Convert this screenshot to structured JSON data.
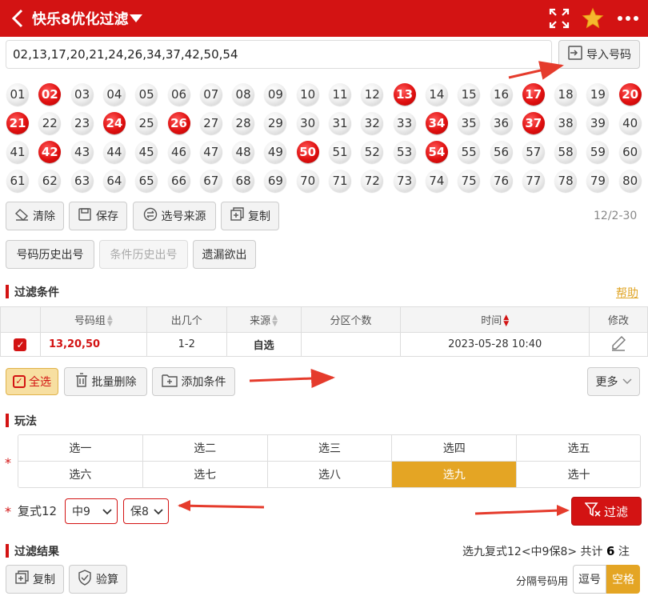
{
  "header": {
    "title": "快乐8优化过滤",
    "icons": [
      "back-arrow-icon",
      "dropdown-caret-icon",
      "fullscreen-icon",
      "star-icon",
      "more-icon"
    ]
  },
  "input": {
    "value": "02,13,17,20,21,24,26,34,37,42,50,54",
    "import_label": "导入号码"
  },
  "balls": [
    "01",
    "02",
    "03",
    "04",
    "05",
    "06",
    "07",
    "08",
    "09",
    "10",
    "11",
    "12",
    "13",
    "14",
    "15",
    "16",
    "17",
    "18",
    "19",
    "20",
    "21",
    "22",
    "23",
    "24",
    "25",
    "26",
    "27",
    "28",
    "29",
    "30",
    "31",
    "32",
    "33",
    "34",
    "35",
    "36",
    "37",
    "38",
    "39",
    "40",
    "41",
    "42",
    "43",
    "44",
    "45",
    "46",
    "47",
    "48",
    "49",
    "50",
    "51",
    "52",
    "53",
    "54",
    "55",
    "56",
    "57",
    "58",
    "59",
    "60",
    "61",
    "62",
    "63",
    "64",
    "65",
    "66",
    "67",
    "68",
    "69",
    "70",
    "71",
    "72",
    "73",
    "74",
    "75",
    "76",
    "77",
    "78",
    "79",
    "80"
  ],
  "selected_balls": [
    "02",
    "13",
    "17",
    "20",
    "21",
    "24",
    "26",
    "34",
    "37",
    "42",
    "50",
    "54"
  ],
  "toolbar": {
    "clear_label": "清除",
    "save_label": "保存",
    "source_label": "选号来源",
    "copy_label": "复制",
    "range": "12/2-30"
  },
  "history": {
    "number_history_label": "号码历史出号",
    "condition_history_label": "条件历史出号",
    "missing_label": "遗漏欲出"
  },
  "conditions": {
    "section_title": "过滤条件",
    "help_label": "帮助",
    "columns": [
      "号码组",
      "出几个",
      "来源",
      "分区个数",
      "时间",
      "修改"
    ],
    "rows": [
      {
        "group": "13,20,50",
        "count": "1-2",
        "source": "自选",
        "zones": "",
        "time": "2023-05-28 10:40"
      }
    ],
    "select_all_label": "全选",
    "batch_delete_label": "批量删除",
    "add_condition_label": "添加条件",
    "more_label": "更多"
  },
  "play": {
    "section_title": "玩法",
    "options": [
      "选一",
      "选二",
      "选三",
      "选四",
      "选五",
      "选六",
      "选七",
      "选八",
      "选九",
      "选十"
    ],
    "active": "选九",
    "compound_label": "复式12",
    "hit_select": "中9",
    "guarantee_select": "保8",
    "filter_label": "过滤"
  },
  "results": {
    "section_title": "过滤结果",
    "summary_prefix": "选九复式12<中9保8>  共计",
    "summary_count": "6",
    "summary_unit": "注",
    "copy_label": "复制",
    "verify_label": "验算",
    "separator_label": "分隔号码用",
    "comma_label": "逗号",
    "space_label": "空格"
  },
  "colors": {
    "brand_red": "#d31313",
    "gold": "#e4a524",
    "select_all_bg": "#f7dfa1"
  }
}
